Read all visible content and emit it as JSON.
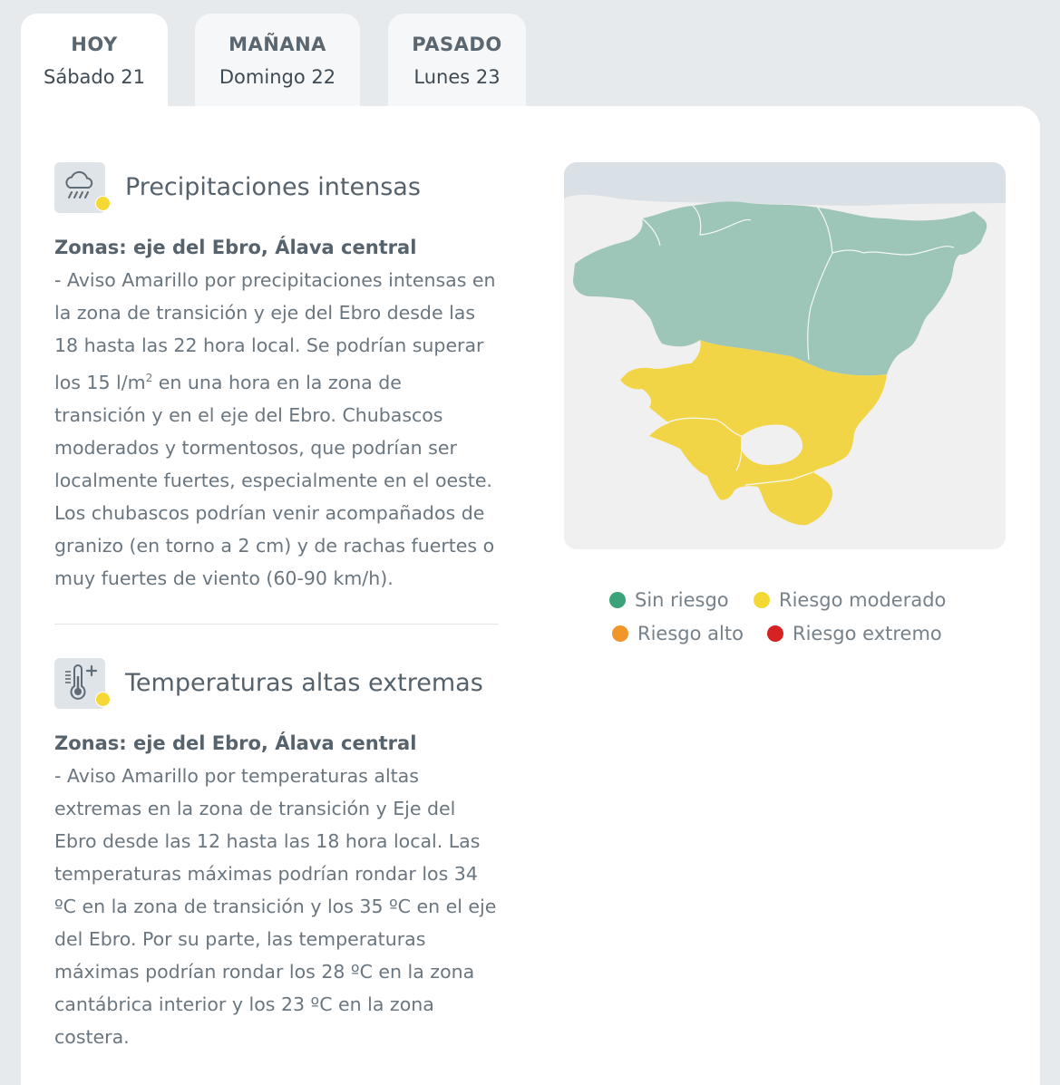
{
  "tabs": [
    {
      "title": "HOY",
      "date": "Sábado 21",
      "active": true
    },
    {
      "title": "MAÑANA",
      "date": "Domingo 22",
      "active": false
    },
    {
      "title": "PASADO",
      "date": "Lunes 23",
      "active": false
    }
  ],
  "warnings": [
    {
      "icon": "rain-cloud-icon",
      "title": "Precipitaciones intensas",
      "zones": "Zonas: eje del Ebro, Álava central",
      "text_before_sup": "- Aviso Amarillo por precipitaciones intensas en la zona de transición y eje del Ebro desde las 18 hasta las 22 hora local. Se podrían superar los 15 l/m",
      "sup": "2",
      "text_after_sup": " en una hora en la zona de transición y en el eje del Ebro. Chubascos moderados y tormentosos, que podrían ser localmente fuertes, especialmente en el oeste. Los chubascos podrían venir acompañados de granizo (en torno a 2 cm) y de rachas fuertes o muy fuertes de viento (60-90 km/h)."
    },
    {
      "icon": "thermometer-plus-icon",
      "title": "Temperaturas altas extremas",
      "zones": "Zonas: eje del Ebro, Álava central",
      "text": "- Aviso Amarillo por temperaturas altas extremas en la zona de transición y Eje del Ebro desde las 12 hasta las 18 hora local. Las temperaturas máximas podrían rondar los 34 ºC en la zona de transición y los 35 ºC en el eje del Ebro. Por su parte, las temperaturas máximas podrían rondar los 28 ºC en la zona cantábrica interior y los 23 ºC en la zona costera."
    }
  ],
  "legend": [
    {
      "label": "Sin riesgo",
      "color": "#3aa377"
    },
    {
      "label": "Riesgo moderado",
      "color": "#f5d833"
    },
    {
      "label": "Riesgo alto",
      "color": "#f0962b"
    },
    {
      "label": "Riesgo extremo",
      "color": "#d62222"
    }
  ],
  "colors": {
    "sea": "#d9e0e6",
    "no_risk_region": "#9dc5b8",
    "moderate_region": "#f2d546",
    "warning_dot": "#f5d833"
  }
}
